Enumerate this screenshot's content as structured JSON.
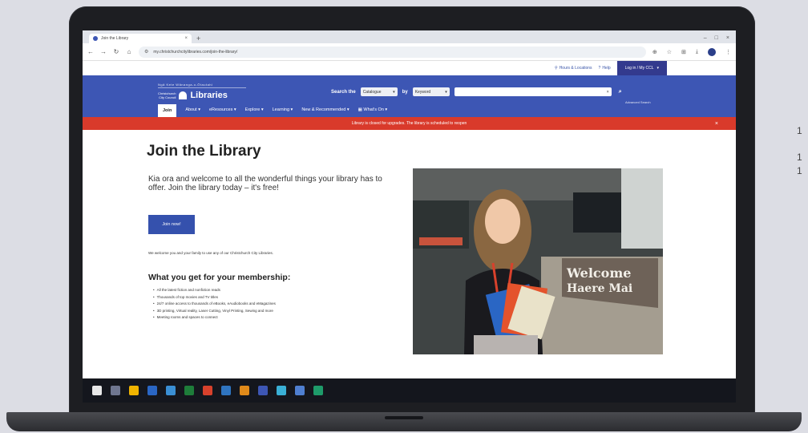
{
  "browser": {
    "tab": {
      "title": "Join the Library",
      "close": "×"
    },
    "new_tab": "+",
    "win": {
      "min": "–",
      "max": "□",
      "close": "×"
    },
    "nav": {
      "back": "←",
      "forward": "→",
      "reload": "↻",
      "home": "⌂"
    },
    "url": "my.christchurchcitylibraries.com/join-the-library/",
    "site_info_glyph": "⚙",
    "icons": {
      "zoom": "⊕",
      "star": "☆",
      "extensions": "⊞",
      "download": "⤓",
      "menu": "⋮"
    }
  },
  "utility_bar": {
    "hours": "Hours & Locations",
    "help": "Help",
    "login": "Log in / My CCL"
  },
  "header": {
    "tagline": "Ngā Kete Wānanga-o-Ōtautahi",
    "council_line1": "Christchurch",
    "council_line2": "City Council",
    "brand": "Libraries",
    "search_label": "Search the",
    "catalogue": "Catalogue",
    "by_label": "by",
    "keyword": "Keyword",
    "search_glyph": "⌕",
    "advanced": "Advanced Search",
    "nav": [
      "Join",
      "About",
      "eResources",
      "Explore",
      "Learning",
      "New & Recommended",
      "What's On"
    ]
  },
  "alert": {
    "text": "Library is closed for upgrades. The library is scheduled to reopen",
    "close": "×"
  },
  "content": {
    "title": "Join the Library",
    "intro": "Kia ora and welcome to all the wonderful things your library has to offer. Join the library today – it's free!",
    "join_button": "Join now!",
    "welcome": "We welcome you and your family to use any of our Christchurch City Libraries.",
    "membership_heading": "What you get for your membership:",
    "benefits": [
      "All the latest fiction and nonfiction reads",
      "Thousands of top movies and TV titles",
      "24/7 online access to thousands of eBooks, eAudiobooks and eMagazines",
      "3D printing, Virtual reality, Laser Cutting, Vinyl Printing, Sewing and more",
      "Meeting rooms and spaces to connect"
    ],
    "photo_sign_line1": "Welcome",
    "photo_sign_line2": "Haere Mai"
  },
  "taskbar": {
    "apps": [
      "#6f7690",
      "#2a66c4",
      "#f0b400",
      "#2f74c0",
      "#3a8fd4",
      "#1e7d3a",
      "#d8412c",
      "#e08a1a",
      "#3d56b4",
      "#3ab0d6",
      "#4f7fd1",
      "#e8e8e8",
      "#1e9b6a"
    ]
  },
  "side_numbers": [
    "1",
    "1",
    "1"
  ]
}
